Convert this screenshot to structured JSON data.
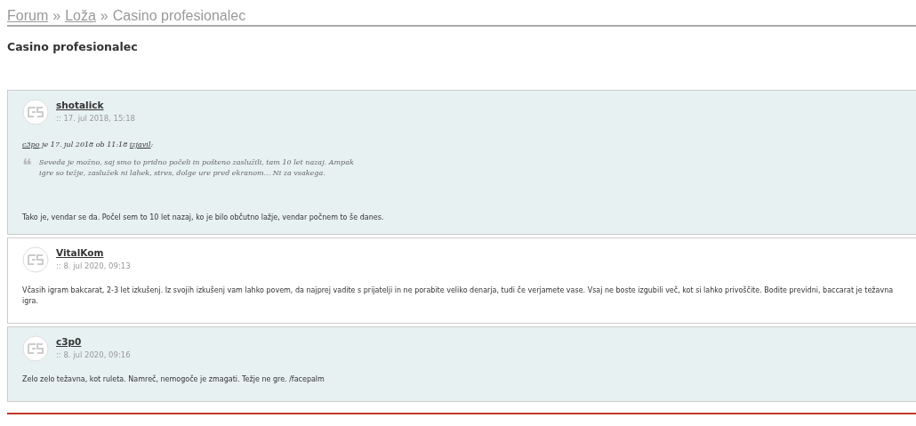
{
  "breadcrumb": [
    {
      "label": "Forum",
      "link": true
    },
    {
      "label": "»",
      "link": false
    },
    {
      "label": "Loža",
      "link": true
    },
    {
      "label": "»",
      "link": false
    },
    {
      "label": "Casino profesionalec",
      "link": false
    }
  ],
  "title": "Casino profesionalec",
  "posts": [
    {
      "kind": "shaded",
      "author": "shotalick",
      "date": ":: 17. jul 2018, 15:18",
      "quote": {
        "author": "c3po",
        "meta": " je 17. jul 2018 ob 11:18 ",
        "said": "izjavil",
        "colon": ":",
        "mark": "❝",
        "text": "Seveda je možno, saj smo to pridno počeli in pošteno zaslužili, tam 10 let nazaj. Ampak igre so težje, zaslužek ni lahek, stres, dolge ure pred ekranom... Ni za vsakega."
      },
      "body": "Tako je, vendar se da. Počel sem to 10 let nazaj, ko je bilo občutno lažje, vendar počnem to še danes."
    },
    {
      "kind": "plain",
      "author": "VitalKom",
      "date": ":: 8. jul 2020, 09:13",
      "body": "Včasih igram bakcarat, 2-3 let izkušenj. Iz svojih izkušenj vam lahko povem, da najprej vadite s prijatelji in ne porabite veliko denarja, tudi če verjamete vase. Vsaj ne boste izgubili več, kot si lahko privoščite. Bodite previdni, baccarat je težavna igra."
    },
    {
      "kind": "shaded",
      "author": "c3p0",
      "date": ":: 8. jul 2020, 09:16",
      "body": "Zelo zelo težavna, kot ruleta. Namreč, nemogoče je zmagati. Težje ne gre. /facepalm"
    }
  ]
}
